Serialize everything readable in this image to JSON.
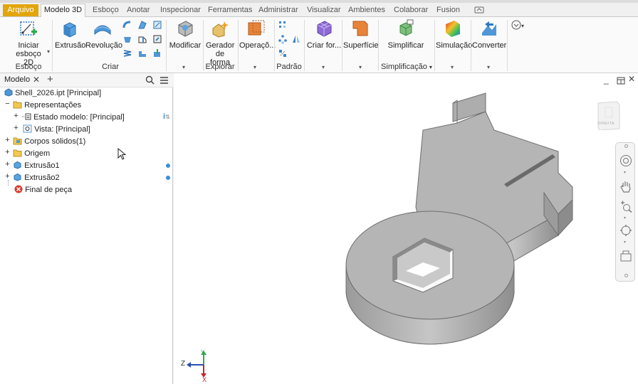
{
  "ribbon": {
    "tabs": [
      "Arquivo",
      "Modelo 3D",
      "Esboço",
      "Anotar",
      "Inspecionar",
      "Ferramentas",
      "Administrar",
      "Visualizar",
      "Ambientes",
      "Colaborar",
      "Fusion"
    ],
    "active_tab": "Modelo 3D",
    "buttons": {
      "iniciar_esboco": "Iniciar esboço 2D",
      "extrusao": "Extrusão",
      "revolucao": "Revolução",
      "modificar": "Modificar",
      "gerador_forma": "Gerador de forma",
      "operacoes": "Operaçõ...",
      "criar_forma": "Criar for...",
      "superficie": "Superfície",
      "simplificar": "Simplificar",
      "simulacao": "Simulação",
      "converter": "Converter"
    },
    "groups": {
      "esboco": "Esboço",
      "criar": "Criar",
      "explorar": "Explorar",
      "padrao": "Padrão",
      "simplificacao": "Simplificação"
    }
  },
  "browser": {
    "tab_label": "Modelo",
    "tree": {
      "root": "Shell_2026.ipt [Principal]",
      "representacoes": "Representações",
      "estado_modelo": "Estado modelo: [Principal]",
      "vista": "Vista: [Principal]",
      "corpos": "Corpos sólidos(1)",
      "origem": "Origem",
      "extrusao1": "Extrusão1",
      "extrusao2": "Extrusão2",
      "final": "Final de peça"
    }
  },
  "viewport": {
    "viewcube_label": "DIREITA",
    "axes": {
      "x": "X",
      "y": "Y",
      "z": "Z"
    }
  },
  "colors": {
    "arquivo_tab": "#e2a50b",
    "part_face": "#b8b8b8",
    "accent_blue": "#3a8fd8"
  }
}
